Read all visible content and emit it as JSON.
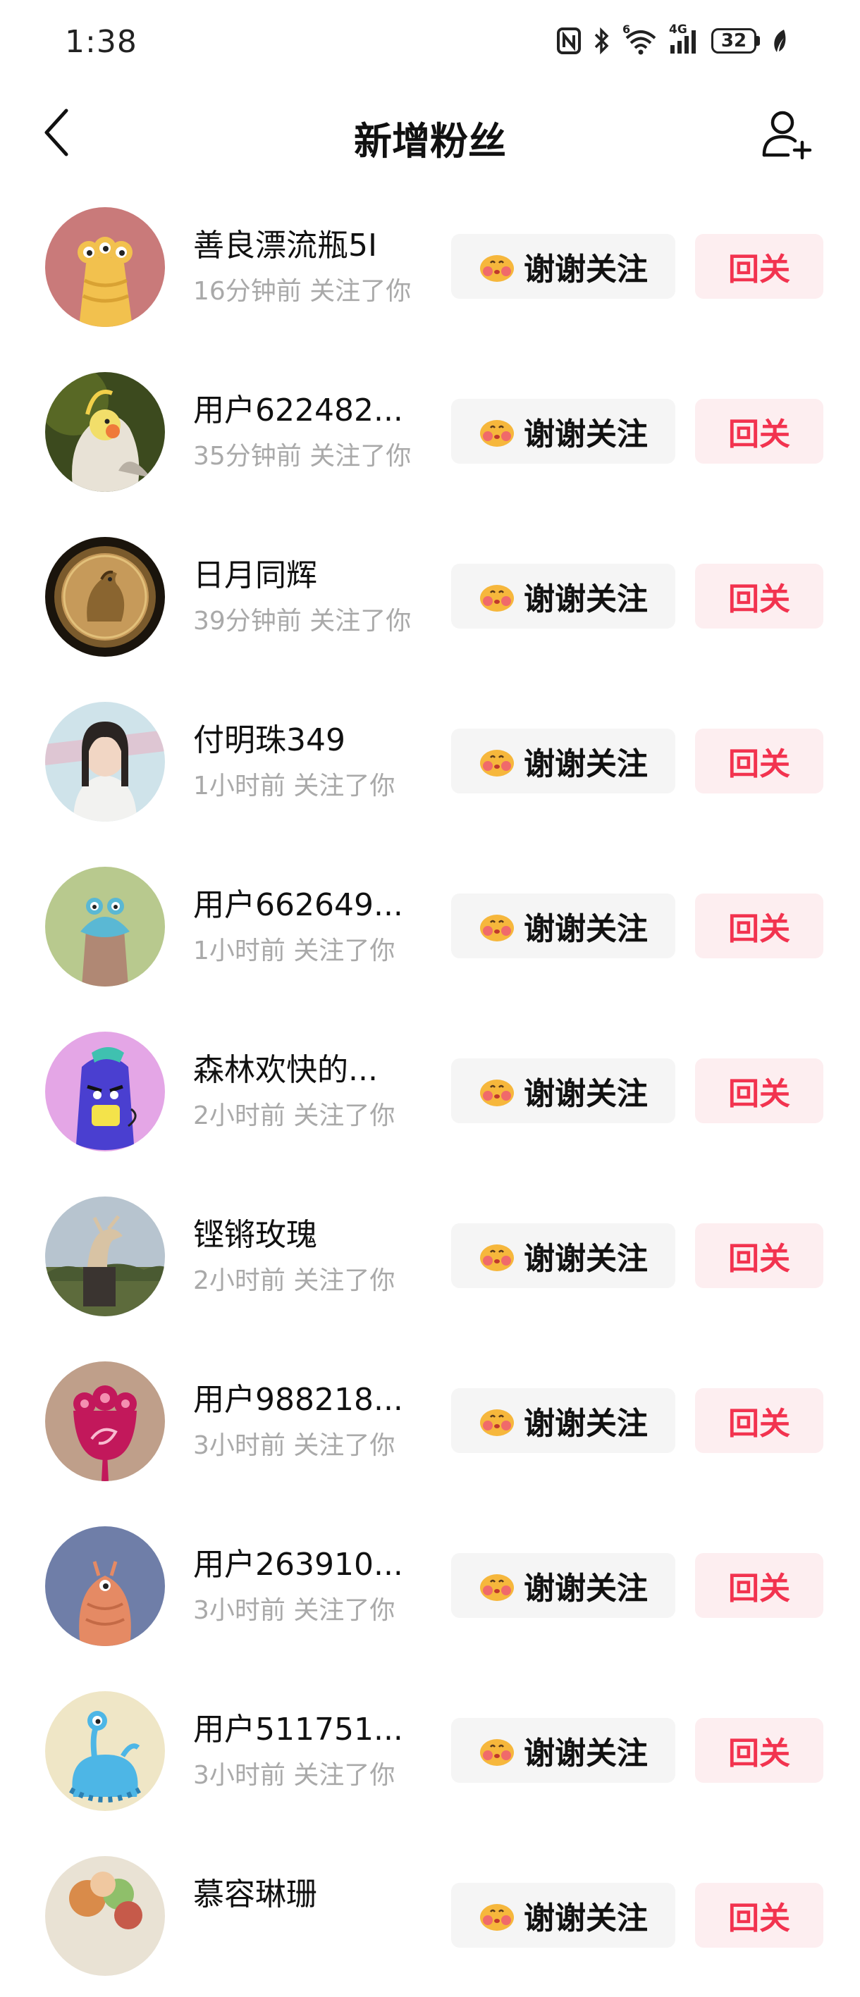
{
  "status_bar": {
    "time": "1:38",
    "network": "4G",
    "wifi_badge": "6",
    "battery": "32"
  },
  "header": {
    "title": "新增粉丝"
  },
  "colors": {
    "accent": "#f2334f",
    "follow_bg": "#fdeef0",
    "thanks_bg": "#f5f5f5",
    "meta_text": "#a9a9a9"
  },
  "buttons": {
    "thanks_label": "谢谢关注",
    "follow_back_label": "回关"
  },
  "followers": [
    {
      "name": "善良漂流瓶5I",
      "time": "16分钟前 关注了你",
      "avatar": "yellow-cartoon"
    },
    {
      "name": "用户622482...",
      "time": "35分钟前 关注了你",
      "avatar": "cockatiel-photo"
    },
    {
      "name": "日月同辉",
      "time": "39分钟前 关注了你",
      "avatar": "rooster-coin"
    },
    {
      "name": "付明珠349",
      "time": "1小时前 关注了你",
      "avatar": "girl-photo"
    },
    {
      "name": "用户662649...",
      "time": "1小时前 关注了你",
      "avatar": "green-cartoon"
    },
    {
      "name": "森林欢快的...",
      "time": "2小时前 关注了你",
      "avatar": "purple-cartoon"
    },
    {
      "name": "铿锵玫瑰",
      "time": "2小时前 关注了你",
      "avatar": "statue-photo"
    },
    {
      "name": "用户988218...",
      "time": "3小时前 关注了你",
      "avatar": "red-flower-cartoon"
    },
    {
      "name": "用户263910...",
      "time": "3小时前 关注了你",
      "avatar": "blue-cartoon"
    },
    {
      "name": "用户511751...",
      "time": "3小时前 关注了你",
      "avatar": "alien-cartoon"
    },
    {
      "name": "慕容琳珊",
      "time": "",
      "avatar": "food-photo"
    }
  ]
}
